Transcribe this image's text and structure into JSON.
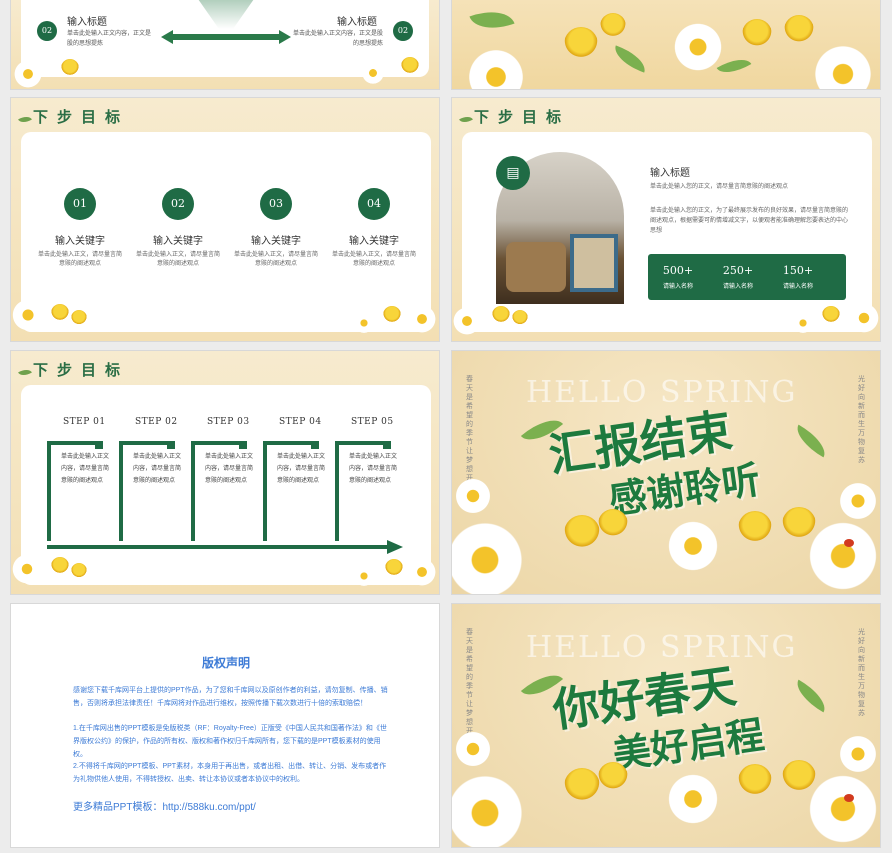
{
  "s1": {
    "left_num": "02",
    "left_title": "输入标题",
    "left_desc": "单击此处输入正文内容，正文是 股的思想提炼",
    "right_num": "02",
    "right_title": "输入标题",
    "right_desc": "单击此处输入正文内容，正文是股的思想提炼"
  },
  "s3": {
    "header": "下步目标",
    "items": [
      {
        "num": "01",
        "title": "输入关键字",
        "desc": "单击此处输入正文，请尽量言简意赅的阐述观点"
      },
      {
        "num": "02",
        "title": "输入关键字",
        "desc": "单击此处输入正文，请尽量言简意赅的阐述观点"
      },
      {
        "num": "03",
        "title": "输入关键字",
        "desc": "单击此处输入正文，请尽量言简意赅的阐述观点"
      },
      {
        "num": "04",
        "title": "输入关键字",
        "desc": "单击此处输入正文，请尽量言简意赅的阐述观点"
      }
    ]
  },
  "s4": {
    "header": "下步目标",
    "title": "输入标题",
    "p1": "单击此处输入您的正文，请尽量言简意赅的阐述观点",
    "p2": "单击此处输入您的正文，为了最终展示发布的良好效果，请尽量言简意赅的阐述观点，根据需要可酌情增减文字，以便观者能准确理解您要表达的中心思想",
    "stats": [
      {
        "n": "500+",
        "l": "请输入名称"
      },
      {
        "n": "250+",
        "l": "请输入名称"
      },
      {
        "n": "150+",
        "l": "请输入名称"
      }
    ]
  },
  "s5": {
    "header": "下步目标",
    "steps": [
      {
        "label": "STEP 01",
        "desc": "单击此处输入正文内容，请尽量言简意赅的阐述观点"
      },
      {
        "label": "STEP 02",
        "desc": "单击此处输入正文内容，请尽量言简意赅的阐述观点"
      },
      {
        "label": "STEP 03",
        "desc": "单击此处输入正文内容，请尽量言简意赅的阐述观点"
      },
      {
        "label": "STEP 04",
        "desc": "单击此处输入正文内容，请尽量言简意赅的阐述观点"
      },
      {
        "label": "STEP 05",
        "desc": "单击此处输入正文内容，请尽量言简意赅的阐述观点"
      }
    ]
  },
  "s6": {
    "hello": "HELLO SPRING",
    "line1": "汇报结束",
    "line2": "感谢聆听",
    "vert_left": "春天是希望的季节 让梦想开花",
    "vert_right": "光好向新而生 万物复苏"
  },
  "s7": {
    "title": "版权声明",
    "p1": "感谢您下载千库网平台上提供的PPT作品，为了您和千库网以及原创作者的利益，请勿复制、传播、销售，否则将承担法律责任！千库网将对作品进行维权，按照传播下载次数进行十倍的索取赔偿！",
    "p2": "1.在千库网出售的PPT模板是免版税类（RF：Royalty-Free）正版受《中国人民共和国著作法》和《世界版权公约》的保护，作品的所有权、版权和著作权归千库网所有，您下载的是PPT模板素材的使用权。",
    "p3": "2.不得将千库网的PPT模板、PPT素材，本身用于再出售，或者出租、出借、转让、分销、发布或者作为礼物供他人使用，不得转授权、出卖、转让本协议或者本协议中的权利。",
    "more": "更多精品PPT模板：http://588ku.com/ppt/"
  },
  "s8": {
    "hello": "HELLO SPRING",
    "line1": "你好春天",
    "line2": "美好启程",
    "vert_left": "春天是希望的季节 让梦想开花",
    "vert_right": "光好向新而生 万物复苏"
  }
}
